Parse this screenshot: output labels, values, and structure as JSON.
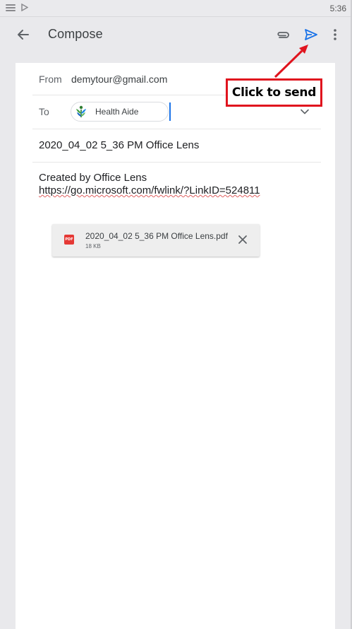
{
  "status_bar": {
    "time": "5:36"
  },
  "app_bar": {
    "title": "Compose",
    "icons": [
      "back-arrow-icon",
      "paperclip-icon",
      "send-icon",
      "more-vert-icon"
    ]
  },
  "compose": {
    "from_label": "From",
    "from_value": "demytour@gmail.com",
    "to_label": "To",
    "to_recipient": "Health Aide",
    "subject": "2020_04_02 5_36 PM Office Lens",
    "body_line1": "Created by Office Lens",
    "body_link": "https://go.microsoft.com/fwlink/?LinkID=524811"
  },
  "attachment": {
    "icon_label": "PDF",
    "file_name": "2020_04_02 5_36 PM Office Lens.pdf",
    "file_size": "18 KB"
  },
  "annotation": {
    "callout_text": "Click to send"
  },
  "colors": {
    "accent_blue": "#1a73e8",
    "callout_red": "#e0141e",
    "pdf_red": "#e53935"
  }
}
